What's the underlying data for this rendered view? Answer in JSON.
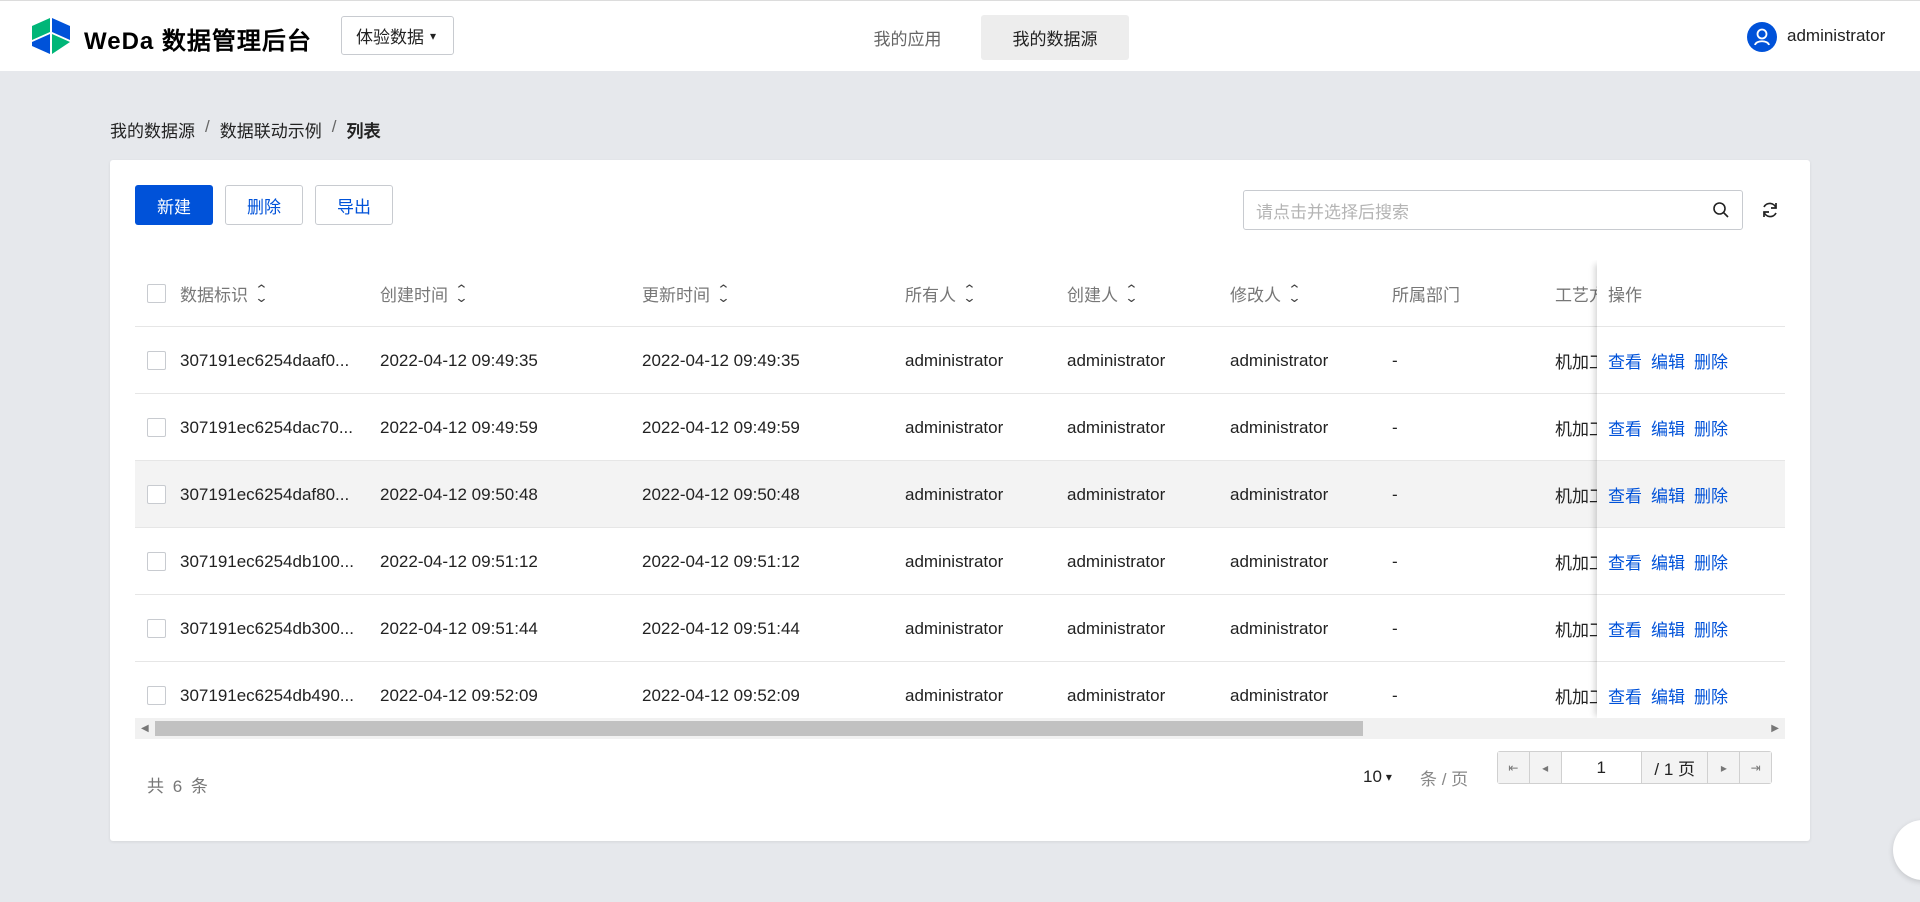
{
  "header": {
    "brand": "WeDa 数据管理后台",
    "env_select": "体验数据",
    "nav": [
      "我的应用",
      "我的数据源"
    ],
    "user": "administrator"
  },
  "breadcrumb": [
    "我的数据源",
    "数据联动示例",
    "列表"
  ],
  "toolbar": {
    "new_label": "新建",
    "delete_label": "删除",
    "export_label": "导出"
  },
  "search": {
    "placeholder": "请点击并选择后搜索"
  },
  "table": {
    "headers": [
      "数据标识",
      "创建时间",
      "更新时间",
      "所有人",
      "创建人",
      "修改人",
      "所属部门",
      "工艺方",
      "操作"
    ],
    "rows": [
      {
        "id": "307191ec6254daaf0...",
        "created": "2022-04-12 09:49:35",
        "updated": "2022-04-12 09:49:35",
        "owner": "administrator",
        "creator": "administrator",
        "modifier": "administrator",
        "dept": "-",
        "craft": "机加工"
      },
      {
        "id": "307191ec6254dac70...",
        "created": "2022-04-12 09:49:59",
        "updated": "2022-04-12 09:49:59",
        "owner": "administrator",
        "creator": "administrator",
        "modifier": "administrator",
        "dept": "-",
        "craft": "机加工"
      },
      {
        "id": "307191ec6254daf80...",
        "created": "2022-04-12 09:50:48",
        "updated": "2022-04-12 09:50:48",
        "owner": "administrator",
        "creator": "administrator",
        "modifier": "administrator",
        "dept": "-",
        "craft": "机加工"
      },
      {
        "id": "307191ec6254db100...",
        "created": "2022-04-12 09:51:12",
        "updated": "2022-04-12 09:51:12",
        "owner": "administrator",
        "creator": "administrator",
        "modifier": "administrator",
        "dept": "-",
        "craft": "机加工"
      },
      {
        "id": "307191ec6254db300...",
        "created": "2022-04-12 09:51:44",
        "updated": "2022-04-12 09:51:44",
        "owner": "administrator",
        "creator": "administrator",
        "modifier": "administrator",
        "dept": "-",
        "craft": "机加工"
      },
      {
        "id": "307191ec6254db490...",
        "created": "2022-04-12 09:52:09",
        "updated": "2022-04-12 09:52:09",
        "owner": "administrator",
        "creator": "administrator",
        "modifier": "administrator",
        "dept": "-",
        "craft": "机加工"
      }
    ],
    "actions": [
      "查看",
      "编辑",
      "删除"
    ]
  },
  "footer": {
    "total": "共 6 条",
    "page_size": "10",
    "per_page": "条 / 页",
    "current_page": "1",
    "total_pages": "/ 1 页"
  },
  "colors": {
    "primary": "#0052d9",
    "background": "#e6e8ec"
  }
}
